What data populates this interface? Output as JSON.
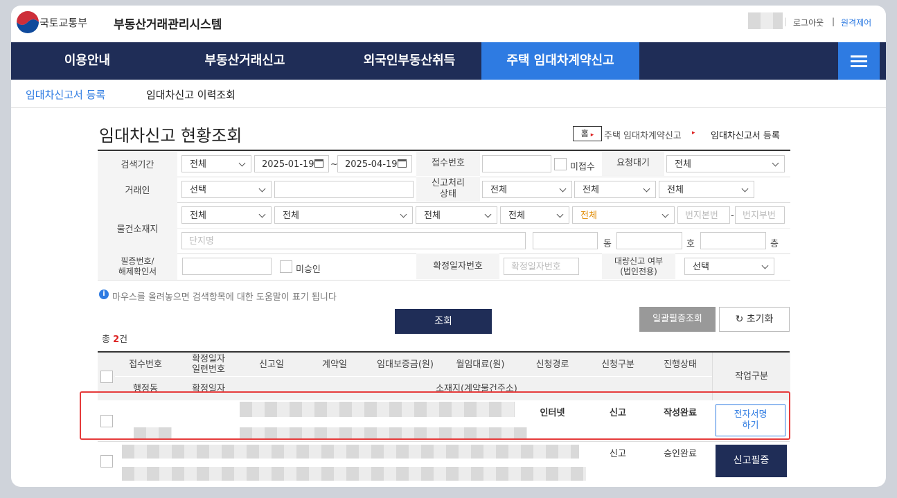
{
  "header": {
    "ministry": "국토교통부",
    "system_name": "부동산거래관리시스템",
    "logout": "로그아웃",
    "remote_control": "원격제어"
  },
  "nav": {
    "items": [
      "이용안내",
      "부동산거래신고",
      "외국인부동산취득",
      "주택 임대차계약신고"
    ],
    "active_index": 3
  },
  "subnav": {
    "items": [
      "임대차신고서 등록",
      "임대차신고 이력조회"
    ],
    "active_index": 0
  },
  "page": {
    "title": "임대차신고 현황조회",
    "breadcrumb": {
      "home": "홈",
      "level1": "주택 임대차계약신고",
      "level2": "임대차신고서 등록"
    }
  },
  "search": {
    "period_label": "검색기간",
    "period_select": "전체",
    "date_from": "2025-01-19",
    "tilde": "~",
    "date_to": "2025-04-19",
    "receipt_no_label": "접수번호",
    "unreceived_label": "미접수",
    "request_wait_label": "요청대기",
    "request_wait_select": "전체",
    "party_label": "거래인",
    "party_select": "선택",
    "report_status_label": "신고처리\n상태",
    "report_status_selects": [
      "전체",
      "전체",
      "전체"
    ],
    "location_label": "물건소재지",
    "location_selects": [
      "전체",
      "전체",
      "전체",
      "전체",
      "전체"
    ],
    "lot_main_placeholder": "번지본번",
    "dash": "-",
    "lot_sub_placeholder": "번지부번",
    "complex_placeholder": "단지명",
    "dong": "동",
    "ho": "호",
    "floor": "층",
    "cert_label": "필증번호/\n해제확인서",
    "unapproved_label": "미승인",
    "fixed_date_no_label": "확정일자번호",
    "fixed_date_no_placeholder": "확정일자번호",
    "bulk_label": "대량신고 여부\n(법인전용)",
    "bulk_select": "선택"
  },
  "info_text": "마우스를 올려놓으면 검색항목에 대한 도움말이 표기 됩니다",
  "buttons": {
    "search": "조회",
    "bulk_cert": "일괄필증조회",
    "reset": "초기화"
  },
  "total": {
    "prefix": "총 ",
    "count": "2",
    "suffix": "건"
  },
  "results": {
    "headers_top": [
      "접수번호",
      "확정일자\n일련번호",
      "신고일",
      "계약일",
      "임대보증금(원)",
      "월임대료(원)",
      "신청경로",
      "신청구분",
      "진행상태"
    ],
    "headers_bottom": [
      "행정동",
      "확정일자",
      "소재지(계약물건주소)"
    ],
    "work_header": "작업구분",
    "rows": [
      {
        "route": "인터넷",
        "type": "신고",
        "status": "작성완료",
        "action": "전자서명\n하기"
      },
      {
        "route": "",
        "type": "신고",
        "status": "승인완료",
        "action": "신고필증"
      }
    ]
  },
  "colors": {
    "nav_bg": "#1f2d57",
    "accent": "#2e7be2",
    "highlight": "#e53a3a"
  }
}
